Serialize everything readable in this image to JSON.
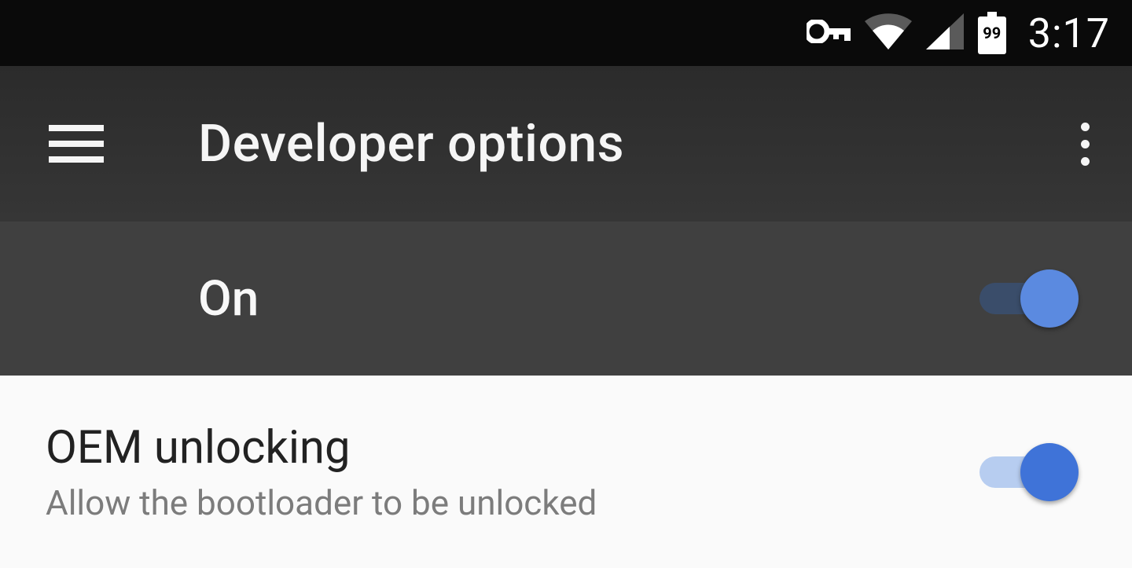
{
  "status_bar": {
    "time": "3:17",
    "battery_level": "99",
    "icons": {
      "vpn": "vpn-key-icon",
      "wifi": "wifi-icon",
      "cell": "cell-signal-icon",
      "battery": "battery-icon"
    }
  },
  "app_bar": {
    "title": "Developer options",
    "menu_icon": "hamburger-icon",
    "overflow_icon": "overflow-icon"
  },
  "master_switch": {
    "label": "On",
    "state": true
  },
  "settings": [
    {
      "title": "OEM unlocking",
      "subtitle": "Allow the bootloader to be unlocked",
      "state": true
    }
  ],
  "colors": {
    "status_bg": "#0a0a0a",
    "appbar_bg": "#303030",
    "master_bg": "#404040",
    "accent": "#4a7ddb",
    "track_dark": "#3a4d6a",
    "track_light": "#b7cdf0"
  }
}
